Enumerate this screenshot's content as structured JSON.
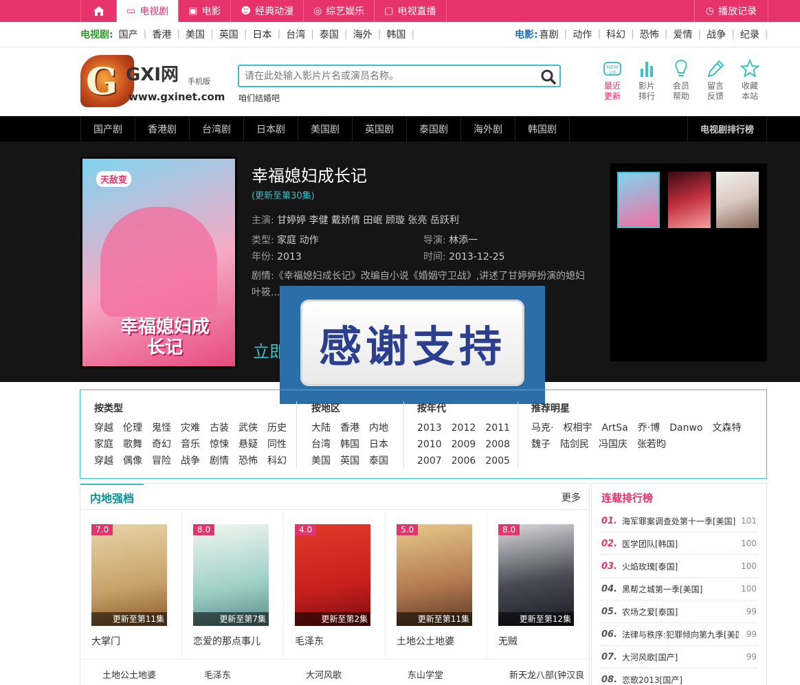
{
  "topnav": {
    "items": [
      {
        "label": "电视剧",
        "icon": "tv-icon"
      },
      {
        "label": "电影",
        "icon": "film-icon"
      },
      {
        "label": "经典动漫",
        "icon": "anime-icon"
      },
      {
        "label": "综艺娱乐",
        "icon": "variety-icon"
      },
      {
        "label": "电视直播",
        "icon": "monitor-icon"
      }
    ],
    "history": "播放记录"
  },
  "subnav": {
    "tv_label": "电视剧:",
    "tv_items": [
      "国产",
      "香港",
      "美国",
      "英国",
      "日本",
      "台湾",
      "泰国",
      "海外",
      "韩国"
    ],
    "movie_label": "电影:",
    "movie_items": [
      "喜剧",
      "动作",
      "科幻",
      "恐怖",
      "爱情",
      "战争",
      "纪录"
    ]
  },
  "logo": {
    "text": "GXI网",
    "sub": "手机版",
    "url": "www.gxinet.com"
  },
  "search": {
    "placeholder": "请在此处输入影片片名或演员名称。",
    "hint": "咱们结婚吧"
  },
  "tools": [
    {
      "label1": "最近",
      "label2": "更新"
    },
    {
      "label1": "影片",
      "label2": "排行"
    },
    {
      "label1": "会员",
      "label2": "帮助"
    },
    {
      "label1": "留言",
      "label2": "反馈"
    },
    {
      "label1": "收藏",
      "label2": "本站"
    }
  ],
  "categories": [
    "国产剧",
    "香港剧",
    "台湾剧",
    "日本剧",
    "美国剧",
    "英国剧",
    "泰国剧",
    "海外剧",
    "韩国剧"
  ],
  "rank_link": "电视剧排行榜",
  "feature": {
    "title": "幸福媳妇成长记",
    "update": "(更新至第30集)",
    "cast_k": "主演:",
    "cast": "甘婷婷 李健 戴娇倩 田岷 顾璇 张亮 岳跃利",
    "type_k": "类型:",
    "type": "家庭 动作",
    "director_k": "导演:",
    "director": "林添一",
    "year_k": "年份:",
    "year": "2013",
    "time_k": "时间:",
    "time": "2013-12-25",
    "desc": "剧情:《幸福媳妇成长记》改编自小说《婚姻守卫战》,讲述了甘婷婷扮演的媳妇叶筱...种问题。该剧由...百万新...",
    "play": "立即",
    "poster_tag": "天敌变",
    "poster_title": "幸福媳妇成长记"
  },
  "badge": "感谢支持",
  "filter": {
    "type_title": "按类型",
    "types": [
      [
        "穿越",
        "伦理",
        "鬼怪",
        "灾难",
        "古装",
        "武侠",
        "历史"
      ],
      [
        "家庭",
        "歌舞",
        "奇幻",
        "音乐",
        "惊悚",
        "悬疑",
        "同性"
      ],
      [
        "穿越",
        "偶像",
        "冒险",
        "战争",
        "剧情",
        "恐怖",
        "科幻"
      ]
    ],
    "area_title": "按地区",
    "areas": [
      [
        "大陆",
        "香港",
        "内地"
      ],
      [
        "台湾",
        "韩国",
        "日本"
      ],
      [
        "美国",
        "英国",
        "泰国"
      ]
    ],
    "year_title": "按年代",
    "years": [
      [
        "2013",
        "2012",
        "2011"
      ],
      [
        "2010",
        "2009",
        "2008"
      ],
      [
        "2007",
        "2006",
        "2005"
      ]
    ],
    "star_title": "推荐明星",
    "stars": [
      [
        "马克·",
        "权相宇",
        "ArtSa",
        "乔·博",
        "Danwo",
        "文森特"
      ],
      [
        "魏子",
        "陆剑民",
        "冯国庆",
        "张若昀"
      ]
    ]
  },
  "section": {
    "title": "内地强档",
    "more": "更多",
    "cards": [
      {
        "score": "7.0",
        "update": "更新至第11集",
        "name": "大掌门",
        "color": "#c8a26a"
      },
      {
        "score": "8.0",
        "update": "更新至第7集",
        "name": "恋爱的那点事儿",
        "color": "#9fd0c8"
      },
      {
        "score": "4.0",
        "update": "更新至第2集",
        "name": "毛泽东",
        "color": "#c8201e"
      },
      {
        "score": "5.0",
        "update": "更新至第11集",
        "name": "土地公土地婆",
        "color": "#b07850"
      },
      {
        "score": "8.0",
        "update": "更新至第12集",
        "name": "无贼",
        "color": "#4a4a55"
      }
    ],
    "links": [
      "土地公土地婆",
      "毛泽东",
      "大河风歌",
      "东山学堂",
      "新天龙八部(钟汉良"
    ]
  },
  "ranking": {
    "title": "连载排行榜",
    "items": [
      {
        "n": "01.",
        "t": "海军罪案调查处第十一季[美国]",
        "c": "101"
      },
      {
        "n": "02.",
        "t": "医学团队[韩国]",
        "c": "100"
      },
      {
        "n": "03.",
        "t": "火焰玫瑰[泰国]",
        "c": "100"
      },
      {
        "n": "04.",
        "t": "黑帮之城第一季[美国]",
        "c": "100"
      },
      {
        "n": "05.",
        "t": "农场之爱[泰国]",
        "c": "99"
      },
      {
        "n": "06.",
        "t": "法律与秩序:犯罪倾向第九季[美国]",
        "c": "99"
      },
      {
        "n": "07.",
        "t": "大河风歌[国产]",
        "c": "99"
      },
      {
        "n": "08.",
        "t": "恋歌2013[国产]",
        "c": ""
      }
    ]
  }
}
